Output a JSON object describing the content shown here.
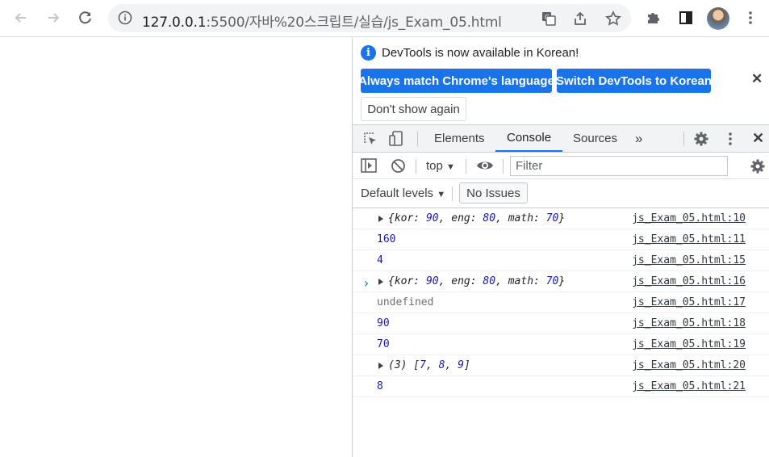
{
  "browser": {
    "url_host": "127.0.0.1",
    "url_path": ":5500/자바%20스크립트/실습/js_Exam_05.html"
  },
  "devtools": {
    "infobar": {
      "message": "DevTools is now available in Korean!",
      "btn_match": "Always match Chrome's language",
      "btn_switch": "Switch DevTools to Korean",
      "btn_dont_show": "Don't show again"
    },
    "tabs": [
      "Elements",
      "Console",
      "Sources"
    ],
    "active_tab": "Console",
    "context": "top",
    "filter_placeholder": "Filter",
    "default_levels": "Default levels",
    "no_issues": "No Issues",
    "console_rows": [
      {
        "type": "object",
        "text": "{kor: 90, eng: 80, math: 70}",
        "source": "js_Exam_05.html:10"
      },
      {
        "type": "number",
        "text": "160",
        "source": "js_Exam_05.html:11"
      },
      {
        "type": "number",
        "text": "4",
        "source": "js_Exam_05.html:15"
      },
      {
        "type": "object",
        "text": "{kor: 90, eng: 80, math: 70}",
        "source": "js_Exam_05.html:16"
      },
      {
        "type": "undefined",
        "text": "undefined",
        "source": "js_Exam_05.html:17"
      },
      {
        "type": "number",
        "text": "90",
        "source": "js_Exam_05.html:18"
      },
      {
        "type": "number",
        "text": "70",
        "source": "js_Exam_05.html:19"
      },
      {
        "type": "array",
        "text": "(3) [7, 8, 9]",
        "source": "js_Exam_05.html:20"
      },
      {
        "type": "number",
        "text": "8",
        "source": "js_Exam_05.html:21"
      }
    ]
  }
}
